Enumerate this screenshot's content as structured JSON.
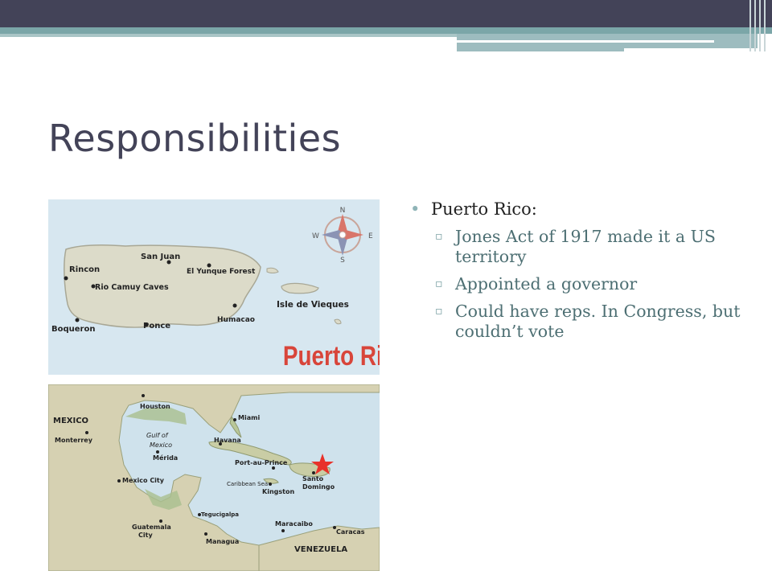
{
  "slide": {
    "title": "Responsibilities",
    "bullet": "Puerto Rico:",
    "sub_bullets": [
      "Jones Act of 1917 made it a US territory",
      "Appointed a governor",
      "Could have reps. In Congress, but couldn’t vote"
    ]
  },
  "map_pr": {
    "compass_n": "N",
    "compass_e": "E",
    "compass_s": "S",
    "compass_w": "W",
    "labels": [
      "San Juan",
      "El Yunque Forest",
      "Rincon",
      "Rio Camuy Caves",
      "Isle de Vieques",
      "Humacao",
      "Boqueron",
      "Ponce"
    ],
    "title": "Puerto Rico"
  },
  "map_caribbean": {
    "labels": [
      "MEXICO",
      "Monterrey",
      "Houston",
      "Miami",
      "Gulf of",
      "Mexico",
      "Havana",
      "Mérida",
      "Port-au-Prince",
      "Mexico City",
      "Caribbean Sea",
      "Santo",
      "Domingo",
      "Kingston",
      "Tegucigalpa",
      "Guatemala",
      "City",
      "Managua",
      "Maracaibo",
      "Caracas",
      "VENEZUELA"
    ]
  },
  "colors": {
    "title": "#434358",
    "band": "#434358",
    "accent": "#7ba6a8",
    "sub_text": "#4d6f73",
    "star": "#e8322a"
  }
}
